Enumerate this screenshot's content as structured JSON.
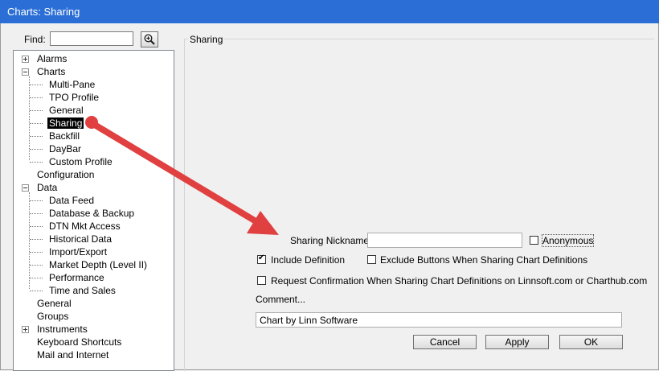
{
  "window": {
    "title": "Charts: Sharing"
  },
  "find": {
    "label": "Find:",
    "value": "",
    "icon": "zoom-in-icon"
  },
  "tree": {
    "nodes": [
      {
        "label": "Alarms",
        "level": 0,
        "expander": "plus"
      },
      {
        "label": "Charts",
        "level": 0,
        "expander": "minus"
      },
      {
        "label": "Multi-Pane",
        "level": 1
      },
      {
        "label": "TPO Profile",
        "level": 1
      },
      {
        "label": "General",
        "level": 1
      },
      {
        "label": "Sharing",
        "level": 1,
        "selected": true
      },
      {
        "label": "Backfill",
        "level": 1
      },
      {
        "label": "DayBar",
        "level": 1
      },
      {
        "label": "Custom Profile",
        "level": 1
      },
      {
        "label": "Configuration",
        "level": 0
      },
      {
        "label": "Data",
        "level": 0,
        "expander": "minus"
      },
      {
        "label": "Data Feed",
        "level": 1
      },
      {
        "label": "Database & Backup",
        "level": 1
      },
      {
        "label": "DTN Mkt Access",
        "level": 1
      },
      {
        "label": "Historical Data",
        "level": 1
      },
      {
        "label": "Import/Export",
        "level": 1
      },
      {
        "label": "Market Depth (Level II)",
        "level": 1
      },
      {
        "label": "Performance",
        "level": 1
      },
      {
        "label": "Time and Sales",
        "level": 1
      },
      {
        "label": "General",
        "level": 0
      },
      {
        "label": "Groups",
        "level": 0
      },
      {
        "label": "Instruments",
        "level": 0,
        "expander": "plus"
      },
      {
        "label": "Keyboard Shortcuts",
        "level": 0
      },
      {
        "label": "Mail and Internet",
        "level": 0
      }
    ]
  },
  "sharing": {
    "group_title": "Sharing",
    "nickname_label": "Sharing Nickname:",
    "nickname_value": "",
    "anonymous_label": "Anonymous",
    "anonymous_checked": false,
    "include_definition_label": "Include Definition",
    "include_definition_checked": true,
    "exclude_buttons_label": "Exclude Buttons When Sharing Chart Definitions",
    "exclude_buttons_checked": false,
    "request_confirmation_label": "Request Confirmation When Sharing Chart Definitions on Linnsoft.com or Charthub.com",
    "request_confirmation_checked": false,
    "comment_label": "Comment...",
    "comment_value": "Chart by Linn Software"
  },
  "buttons": {
    "cancel": "Cancel",
    "apply": "Apply",
    "ok": "OK"
  },
  "annotation": {
    "color": "#e04040"
  }
}
